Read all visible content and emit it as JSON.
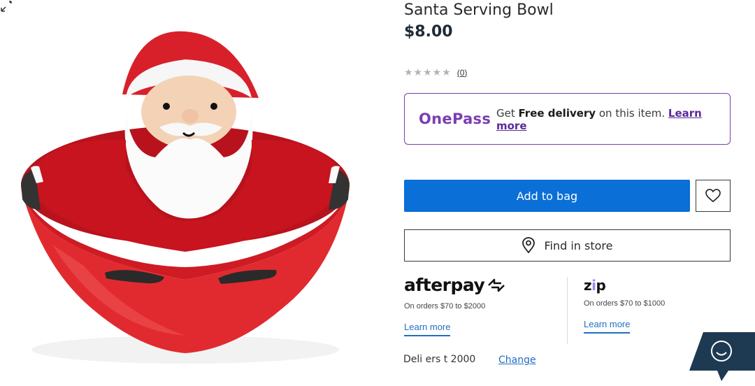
{
  "product": {
    "title": "Santa Serving Bowl",
    "price": "$8.00",
    "rating_stars": "★★★★★",
    "review_count": "(0)"
  },
  "onepass": {
    "logo": "OnePass",
    "text_prefix": "Get ",
    "text_bold": "Free delivery",
    "text_suffix": " on this item. ",
    "learn_more": "Learn more",
    "accent": "#7a3eb1"
  },
  "actions": {
    "add_to_bag": "Add to bag",
    "find_in_store": "Find in store",
    "primary_color": "#0a6fd6"
  },
  "afterpay": {
    "logo": "afterpay",
    "terms": "On orders $70 to $2000",
    "learn_more": "Learn more"
  },
  "zip": {
    "logo_z": "z",
    "logo_i": "i",
    "logo_p": "p",
    "terms": "On orders $70 to $1000",
    "learn_more": "Learn more"
  },
  "delivery": {
    "text": "Deli ers t 2000",
    "change": "Change"
  },
  "icons": {
    "wishlist": "heart-icon",
    "store": "map-pin-icon",
    "expand": "expand-icon",
    "chat": "chat-smile-icon"
  }
}
